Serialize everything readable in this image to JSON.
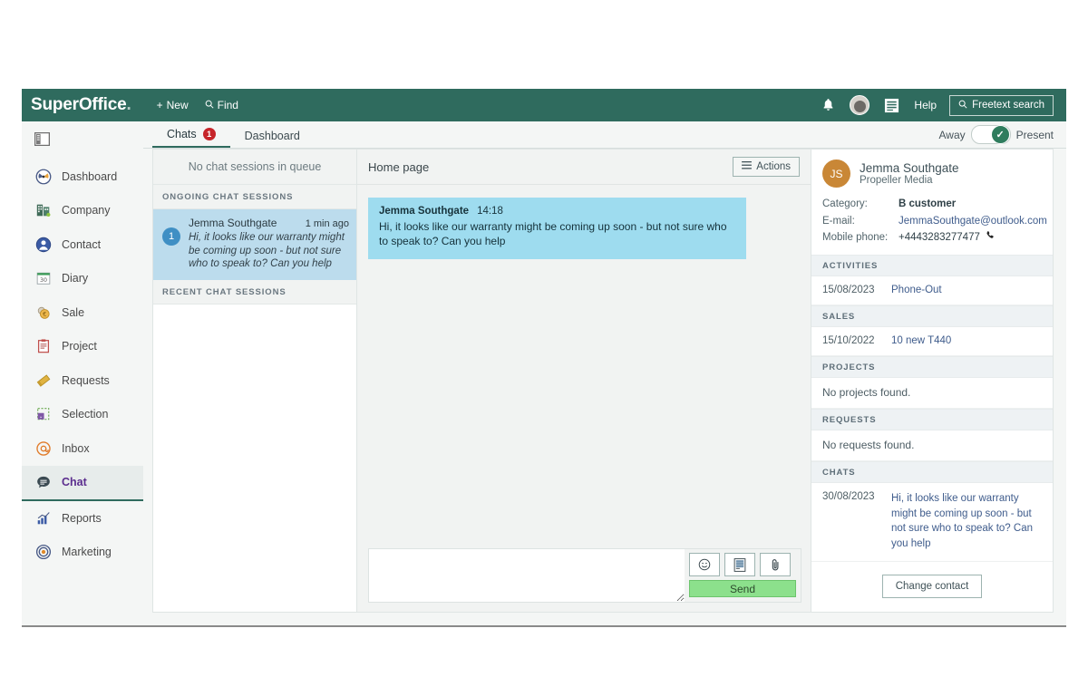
{
  "topbar": {
    "logo_main": "SuperOffice",
    "logo_dot": ".",
    "new_label": "New",
    "find_label": "Find",
    "help_label": "Help",
    "freetext_label": "Freetext search",
    "bell_icon": "bell-icon",
    "avatar_icon": "user-avatar-icon",
    "menu_icon": "hamburger-menu-icon",
    "search_icon": "search-icon",
    "plus_icon": "plus-icon",
    "bg_color": "#2f6b5e"
  },
  "sidebar": {
    "toggle_icon": "panel-layout-icon",
    "items": [
      {
        "label": "Dashboard",
        "icon": "dashboard-gauge-icon",
        "active": false
      },
      {
        "label": "Company",
        "icon": "company-building-icon",
        "active": false
      },
      {
        "label": "Contact",
        "icon": "contact-person-icon",
        "active": false
      },
      {
        "label": "Diary",
        "icon": "diary-calendar-icon",
        "active": false
      },
      {
        "label": "Sale",
        "icon": "sale-coin-icon",
        "active": false
      },
      {
        "label": "Project",
        "icon": "project-clipboard-icon",
        "active": false
      },
      {
        "label": "Requests",
        "icon": "requests-ticket-icon",
        "active": false
      },
      {
        "label": "Selection",
        "icon": "selection-icon",
        "active": false
      },
      {
        "label": "Inbox",
        "icon": "inbox-at-icon",
        "active": false
      },
      {
        "label": "Chat",
        "icon": "chat-bubble-icon",
        "active": true
      },
      {
        "label": "Reports",
        "icon": "reports-bar-chart-icon",
        "active": false
      },
      {
        "label": "Marketing",
        "icon": "marketing-target-icon",
        "active": false
      }
    ],
    "active_color": "#5b2d8e"
  },
  "tabs": {
    "items": [
      {
        "label": "Chats",
        "badge": "1",
        "active": true
      },
      {
        "label": "Dashboard",
        "badge": "",
        "active": false
      }
    ],
    "badge_color": "#c6252a"
  },
  "presence": {
    "away_label": "Away",
    "present_label": "Present",
    "state": "Present",
    "check_icon": "check-icon",
    "on_color": "#2f7d5e"
  },
  "sessions": {
    "queue_empty": "No chat sessions in queue",
    "ongoing_header": "Ongoing chat sessions",
    "recent_header": "Recent chat sessions",
    "ongoing": [
      {
        "badge": "1",
        "name": "Jemma Southgate",
        "time": "1 min ago",
        "snippet": "Hi, it looks like our warranty might be coming up soon - but not sure who to speak to? Can you help",
        "selected": true
      }
    ],
    "recent": []
  },
  "chat": {
    "title": "Home page",
    "actions_label": "Actions",
    "actions_icon": "hamburger-menu-icon",
    "messages": [
      {
        "sender": "Jemma Southgate",
        "time": "14:18",
        "text": "Hi, it looks like our warranty might be coming up soon - but not sure who to speak to? Can you help"
      }
    ],
    "composer": {
      "value": "",
      "placeholder": "",
      "emoji_icon": "smiley-face-icon",
      "template_icon": "document-template-icon",
      "attach_icon": "paperclip-icon",
      "send_label": "Send",
      "send_color": "#8ce08c"
    }
  },
  "contact_panel": {
    "avatar_initials": "JS",
    "avatar_color": "#c98736",
    "name": "Jemma Southgate",
    "company": "Propeller Media",
    "fields": [
      {
        "label": "Category:",
        "value": "B customer",
        "style": "bold"
      },
      {
        "label": "E-mail:",
        "value": "JemmaSouthgate@outlook.com",
        "style": "link"
      },
      {
        "label": "Mobile phone:",
        "value": "+4443283277477",
        "style": "plain",
        "icon": "phone-icon"
      }
    ],
    "sections": [
      {
        "header": "Activities",
        "rows": [
          {
            "date": "15/08/2023",
            "text": "Phone-Out",
            "link": true
          }
        ],
        "empty_text": ""
      },
      {
        "header": "Sales",
        "rows": [
          {
            "date": "15/10/2022",
            "text": "10 new T440",
            "link": true
          }
        ],
        "empty_text": ""
      },
      {
        "header": "Projects",
        "rows": [],
        "empty_text": "No projects found."
      },
      {
        "header": "Requests",
        "rows": [],
        "empty_text": "No requests found."
      },
      {
        "header": "Chats",
        "rows": [
          {
            "date": "30/08/2023",
            "text": "Hi, it looks like our warranty might be coming up soon - but not sure who to speak to? Can you help",
            "link": true
          }
        ],
        "empty_text": ""
      }
    ],
    "change_contact_label": "Change contact"
  }
}
